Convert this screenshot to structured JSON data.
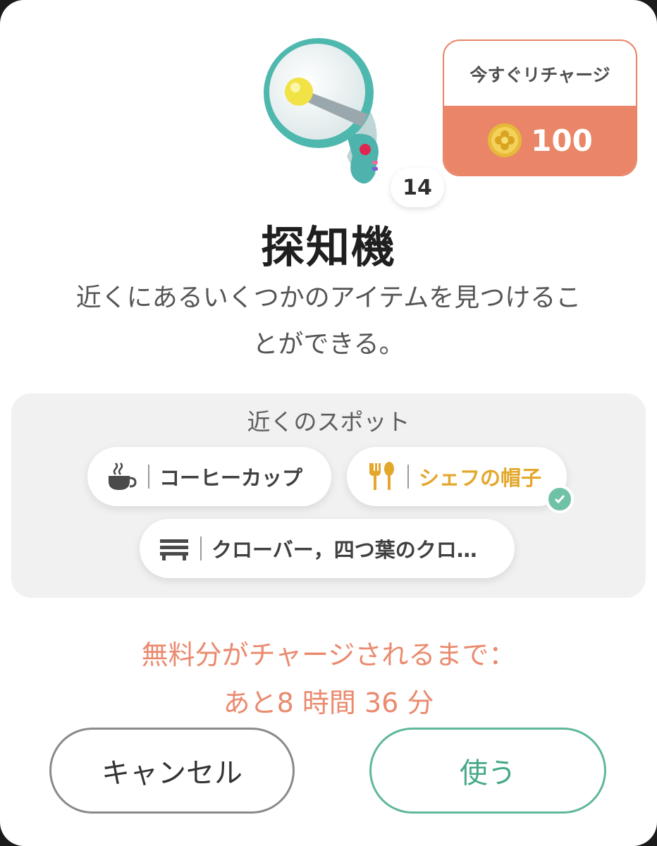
{
  "item": {
    "name": "探知機",
    "count": "14",
    "description_lines": [
      "近くにあるいくつかのアイテムを見つけるこ",
      "とができる。"
    ],
    "icon": "megaphone-detector"
  },
  "recharge": {
    "title": "今すぐリチャージ",
    "price": "100",
    "currency_icon": "gold-coin-icon",
    "accent_color": "#ea8667"
  },
  "spots": {
    "title": "近くのスポット",
    "chips": [
      {
        "label": "コーヒーカップ",
        "icon": "coffee-cup-icon",
        "selected": false
      },
      {
        "label": "シェフの帽子",
        "icon": "fork-spoon-icon",
        "selected": true
      },
      {
        "label": "クローバー，四つ葉のクロ…",
        "icon": "bench-icon",
        "selected": false
      }
    ]
  },
  "countdown": {
    "line1": "無料分がチャージされるまで：",
    "line2": "あと8 時間 36 分",
    "color": "#ea8a6e"
  },
  "buttons": {
    "cancel": "キャンセル",
    "use": "使う",
    "use_color": "#46a987"
  }
}
